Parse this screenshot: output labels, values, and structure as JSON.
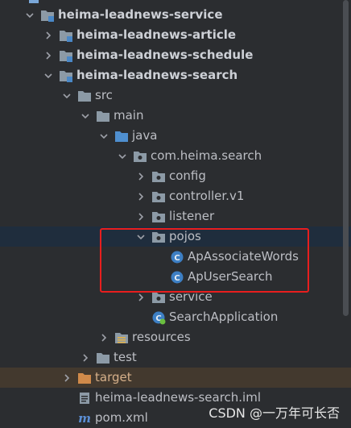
{
  "tree": [
    {
      "label": "heima-leadnews-service",
      "depth": 0,
      "expanded": true,
      "icon": "module-folder-icon",
      "bold": true
    },
    {
      "label": "heima-leadnews-article",
      "depth": 1,
      "expanded": false,
      "icon": "module-folder-icon",
      "bold": true
    },
    {
      "label": "heima-leadnews-schedule",
      "depth": 1,
      "expanded": false,
      "icon": "module-folder-icon",
      "bold": true
    },
    {
      "label": "heima-leadnews-search",
      "depth": 1,
      "expanded": true,
      "icon": "module-folder-icon",
      "bold": true
    },
    {
      "label": "src",
      "depth": 2,
      "expanded": true,
      "icon": "folder-icon"
    },
    {
      "label": "main",
      "depth": 3,
      "expanded": true,
      "icon": "folder-icon"
    },
    {
      "label": "java",
      "depth": 4,
      "expanded": true,
      "icon": "source-folder-icon"
    },
    {
      "label": "com.heima.search",
      "depth": 5,
      "expanded": true,
      "icon": "package-icon"
    },
    {
      "label": "config",
      "depth": 6,
      "expanded": false,
      "icon": "package-icon"
    },
    {
      "label": "controller.v1",
      "depth": 6,
      "expanded": false,
      "icon": "package-icon"
    },
    {
      "label": "listener",
      "depth": 6,
      "expanded": false,
      "icon": "package-icon"
    },
    {
      "label": "pojos",
      "depth": 6,
      "expanded": true,
      "icon": "package-icon",
      "selected": true
    },
    {
      "label": "ApAssociateWords",
      "depth": 7,
      "icon": "class-icon"
    },
    {
      "label": "ApUserSearch",
      "depth": 7,
      "icon": "class-icon"
    },
    {
      "label": "service",
      "depth": 6,
      "expanded": false,
      "icon": "package-icon"
    },
    {
      "label": "SearchApplication",
      "depth": 6,
      "icon": "spring-boot-app-icon"
    },
    {
      "label": "resources",
      "depth": 4,
      "expanded": false,
      "icon": "resources-folder-icon"
    },
    {
      "label": "test",
      "depth": 3,
      "expanded": false,
      "icon": "folder-icon"
    },
    {
      "label": "target",
      "depth": 2,
      "expanded": false,
      "icon": "excluded-folder-icon",
      "target": true
    },
    {
      "label": "heima-leadnews-search.iml",
      "depth": 2,
      "icon": "iml-file-icon"
    },
    {
      "label": "pom.xml",
      "depth": 2,
      "icon": "maven-pom-icon"
    }
  ],
  "watermark": "CSDN @一万年可长否",
  "colors": {
    "background": "#2b2d30",
    "selected_row": "#1f2d3d",
    "target_row": "#43392e",
    "highlight_box": "#e81e1e",
    "folder": "#8c9aa6",
    "source_folder": "#5b9bd5",
    "class_icon": "#3d8bd4"
  }
}
